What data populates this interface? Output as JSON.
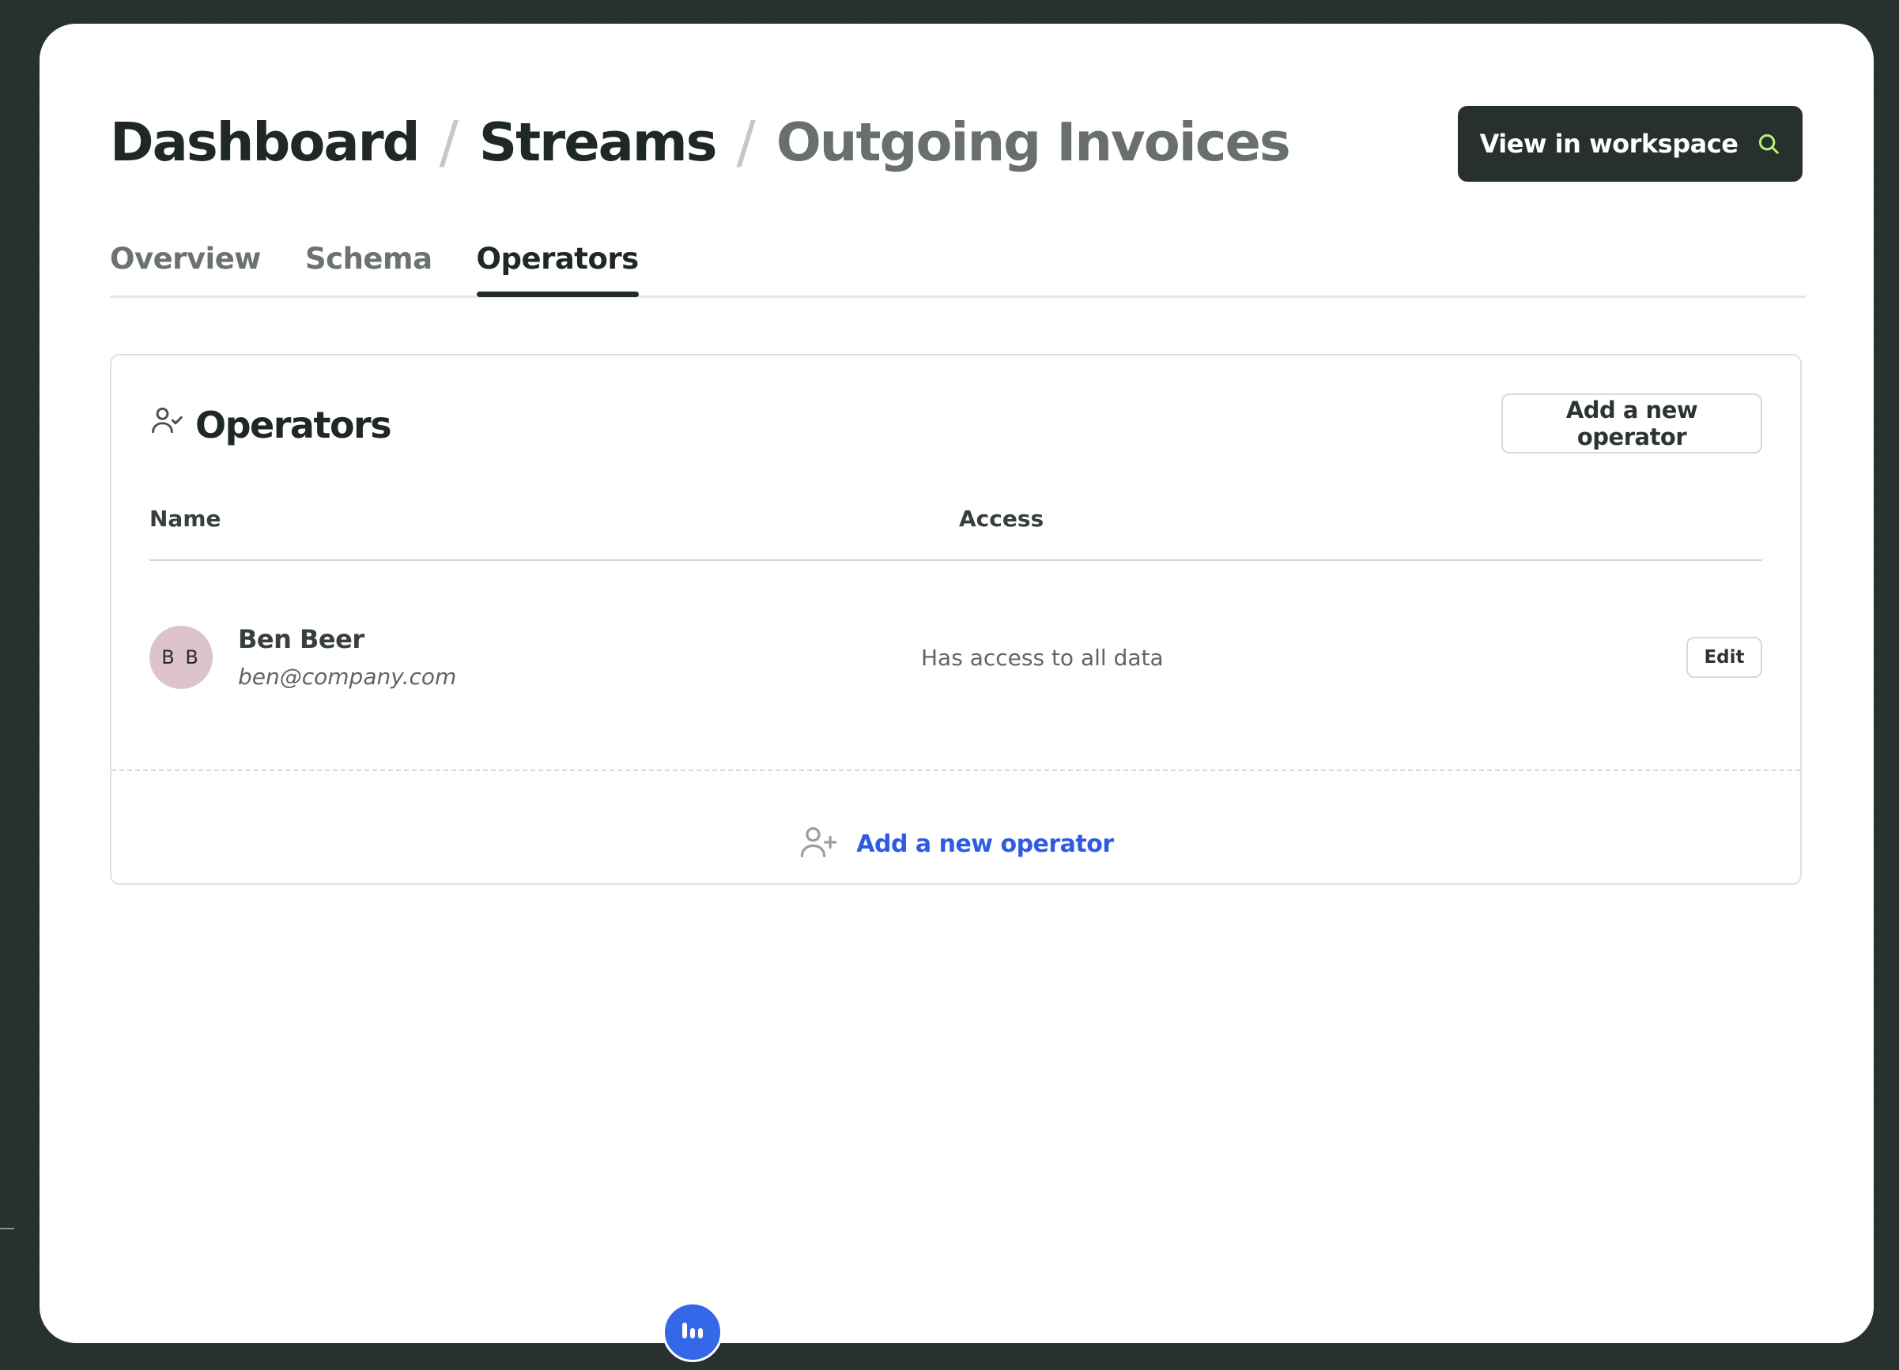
{
  "breadcrumb": {
    "items": [
      "Dashboard",
      "Streams",
      "Outgoing Invoices"
    ],
    "separator": "/"
  },
  "header": {
    "view_button_label": "View in workspace",
    "view_button_icon": "search-icon"
  },
  "tabs": [
    {
      "label": "Overview",
      "active": false
    },
    {
      "label": "Schema",
      "active": false
    },
    {
      "label": "Operators",
      "active": true
    }
  ],
  "operators_card": {
    "title": "Operators",
    "title_icon": "user-check-icon",
    "add_button_label": "Add a new operator",
    "columns": [
      "Name",
      "Access"
    ],
    "rows": [
      {
        "initials": "B B",
        "name": "Ben Beer",
        "email": "ben@company.com",
        "access": "Has access to all data",
        "action_label": "Edit"
      }
    ],
    "footer_add_label": "Add a new operator",
    "footer_add_icon": "user-plus-icon"
  },
  "floating_button": {
    "icon": "bars-icon"
  },
  "colors": {
    "background": "#26302c",
    "primary_dark": "#27302c",
    "accent_icon": "#b8f07a",
    "link_blue": "#2d5be3",
    "fab_blue": "#3568e8",
    "avatar_bg": "#dcc3cc"
  }
}
